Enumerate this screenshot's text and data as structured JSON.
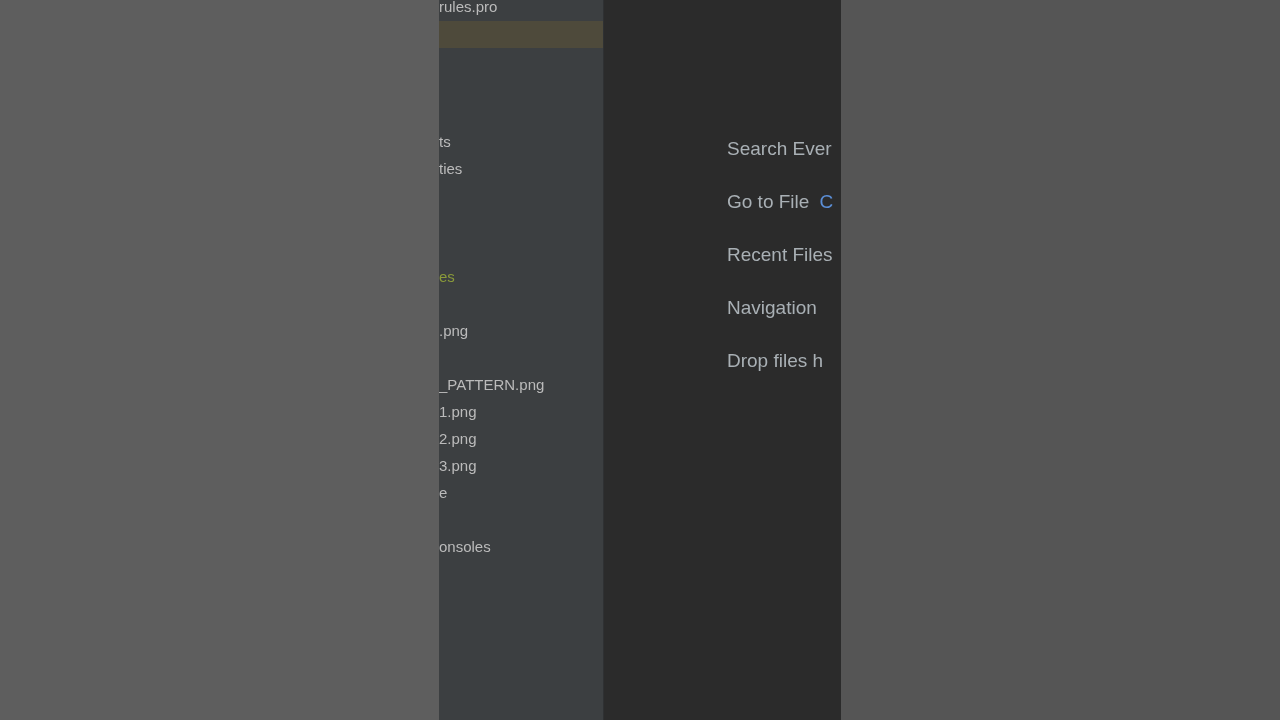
{
  "project_tree": [
    {
      "label": "rules.pro",
      "selected": false,
      "kind": "file"
    },
    {
      "selected": true
    },
    {
      "label": "ts",
      "selected": false,
      "kind": "file"
    },
    {
      "label": "ties",
      "selected": false,
      "kind": "file"
    },
    {
      "label": "es",
      "selected": false,
      "kind": "source"
    },
    {
      "label": ".png",
      "selected": false,
      "kind": "file"
    },
    {
      "label": "_PATTERN.png",
      "selected": false,
      "kind": "file"
    },
    {
      "label": "1.png",
      "selected": false,
      "kind": "file"
    },
    {
      "label": "2.png",
      "selected": false,
      "kind": "file"
    },
    {
      "label": "3.png",
      "selected": false,
      "kind": "file"
    },
    {
      "label": "e",
      "selected": false,
      "kind": "file"
    },
    {
      "label": "onsoles",
      "selected": false,
      "kind": "file"
    }
  ],
  "editor_hints": [
    {
      "label": "Search Ever"
    },
    {
      "label": "Go to File",
      "shortcut": "C"
    },
    {
      "label": "Recent Files"
    },
    {
      "label": "Navigation"
    },
    {
      "label": "Drop files h"
    }
  ]
}
